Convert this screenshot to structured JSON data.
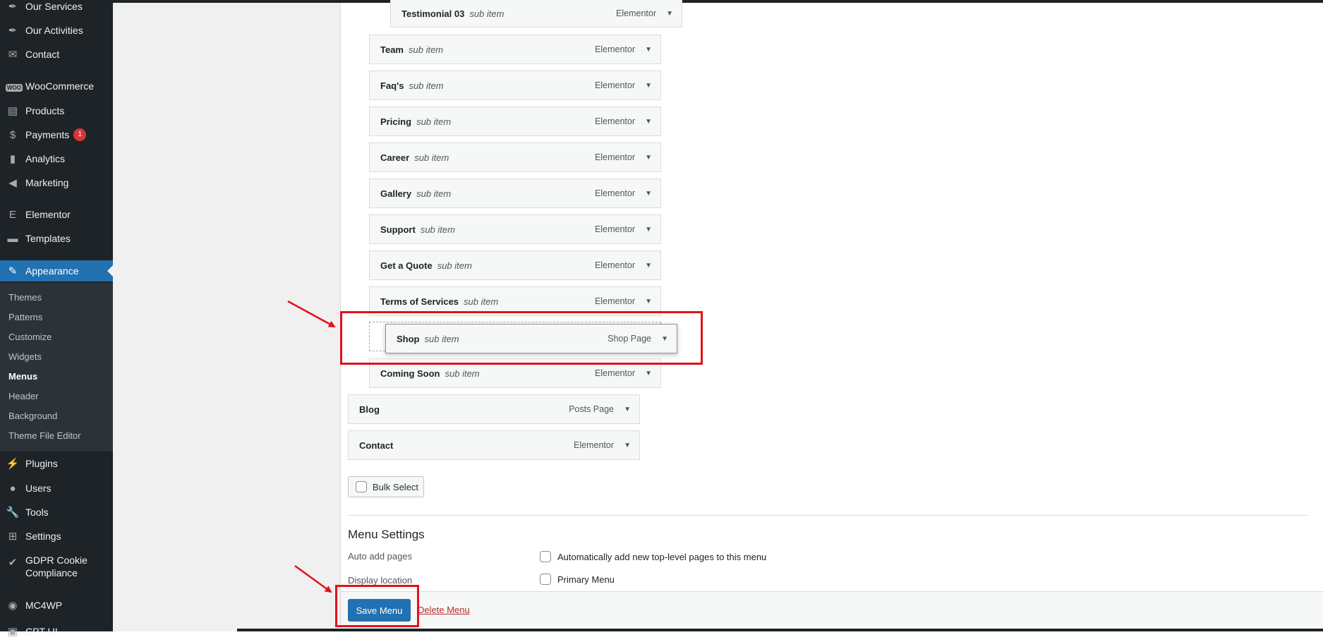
{
  "sidebar": {
    "items": [
      {
        "label": "Our Services",
        "icon": "pin-icon",
        "glyph": "✒"
      },
      {
        "label": "Our Activities",
        "icon": "pin-icon",
        "glyph": "✒"
      },
      {
        "label": "Contact",
        "icon": "mail-icon",
        "glyph": "✉"
      },
      {
        "label": "WooCommerce",
        "icon": "woo-icon",
        "glyph": "WOO"
      },
      {
        "label": "Products",
        "icon": "archive-icon",
        "glyph": "▤"
      },
      {
        "label": "Payments",
        "icon": "dollar-icon",
        "glyph": "$",
        "badge": "1"
      },
      {
        "label": "Analytics",
        "icon": "bar-chart-icon",
        "glyph": "▮"
      },
      {
        "label": "Marketing",
        "icon": "megaphone-icon",
        "glyph": "◀"
      },
      {
        "label": "Elementor",
        "icon": "elementor-icon",
        "glyph": "E"
      },
      {
        "label": "Templates",
        "icon": "folder-icon",
        "glyph": "▬"
      },
      {
        "label": "Appearance",
        "icon": "brush-icon",
        "glyph": "✎"
      },
      {
        "label": "Plugins",
        "icon": "plug-icon",
        "glyph": "⚡"
      },
      {
        "label": "Users",
        "icon": "user-icon",
        "glyph": "●"
      },
      {
        "label": "Tools",
        "icon": "wrench-icon",
        "glyph": "🔧"
      },
      {
        "label": "Settings",
        "icon": "settings-icon",
        "glyph": "⊞"
      },
      {
        "label": "GDPR Cookie Compliance",
        "line1": "GDPR Cookie",
        "line2": "Compliance",
        "icon": "check-shield-icon",
        "glyph": "✔"
      },
      {
        "label": "MC4WP",
        "icon": "mc4wp-icon",
        "glyph": "◉"
      },
      {
        "label": "CPT UI",
        "icon": "cpt-icon",
        "glyph": "▣"
      }
    ],
    "submenu": [
      "Themes",
      "Patterns",
      "Customize",
      "Widgets",
      "Menus",
      "Header",
      "Background",
      "Theme File Editor"
    ],
    "current_sub": "Menus"
  },
  "menu_items": [
    {
      "title": "Testimonial 03",
      "sub": "sub item",
      "type": "Elementor"
    },
    {
      "title": "Team",
      "sub": "sub item",
      "type": "Elementor"
    },
    {
      "title": "Faq's",
      "sub": "sub item",
      "type": "Elementor"
    },
    {
      "title": "Pricing",
      "sub": "sub item",
      "type": "Elementor"
    },
    {
      "title": "Career",
      "sub": "sub item",
      "type": "Elementor"
    },
    {
      "title": "Gallery",
      "sub": "sub item",
      "type": "Elementor"
    },
    {
      "title": "Support",
      "sub": "sub item",
      "type": "Elementor"
    },
    {
      "title": "Get a Quote",
      "sub": "sub item",
      "type": "Elementor"
    },
    {
      "title": "Terms of Services",
      "sub": "sub item",
      "type": "Elementor"
    },
    {
      "title": "Shop",
      "sub": "sub item",
      "type": "Shop Page"
    },
    {
      "title": "Coming Soon",
      "sub": "sub item",
      "type": "Elementor"
    },
    {
      "title": "Blog",
      "sub": "",
      "type": "Posts Page"
    },
    {
      "title": "Contact",
      "sub": "",
      "type": "Elementor"
    }
  ],
  "bulk_select": "Bulk Select",
  "menu_settings": {
    "heading": "Menu Settings",
    "auto_add_label": "Auto add pages",
    "auto_add_option": "Automatically add new top-level pages to this menu",
    "display_location_label": "Display location",
    "primary_option": "Primary Menu"
  },
  "footer": {
    "save": "Save Menu",
    "delete": "Delete Menu"
  },
  "colors": {
    "accent": "#2271b1",
    "sidebar": "#1d2327",
    "annotation": "#e2121a"
  }
}
